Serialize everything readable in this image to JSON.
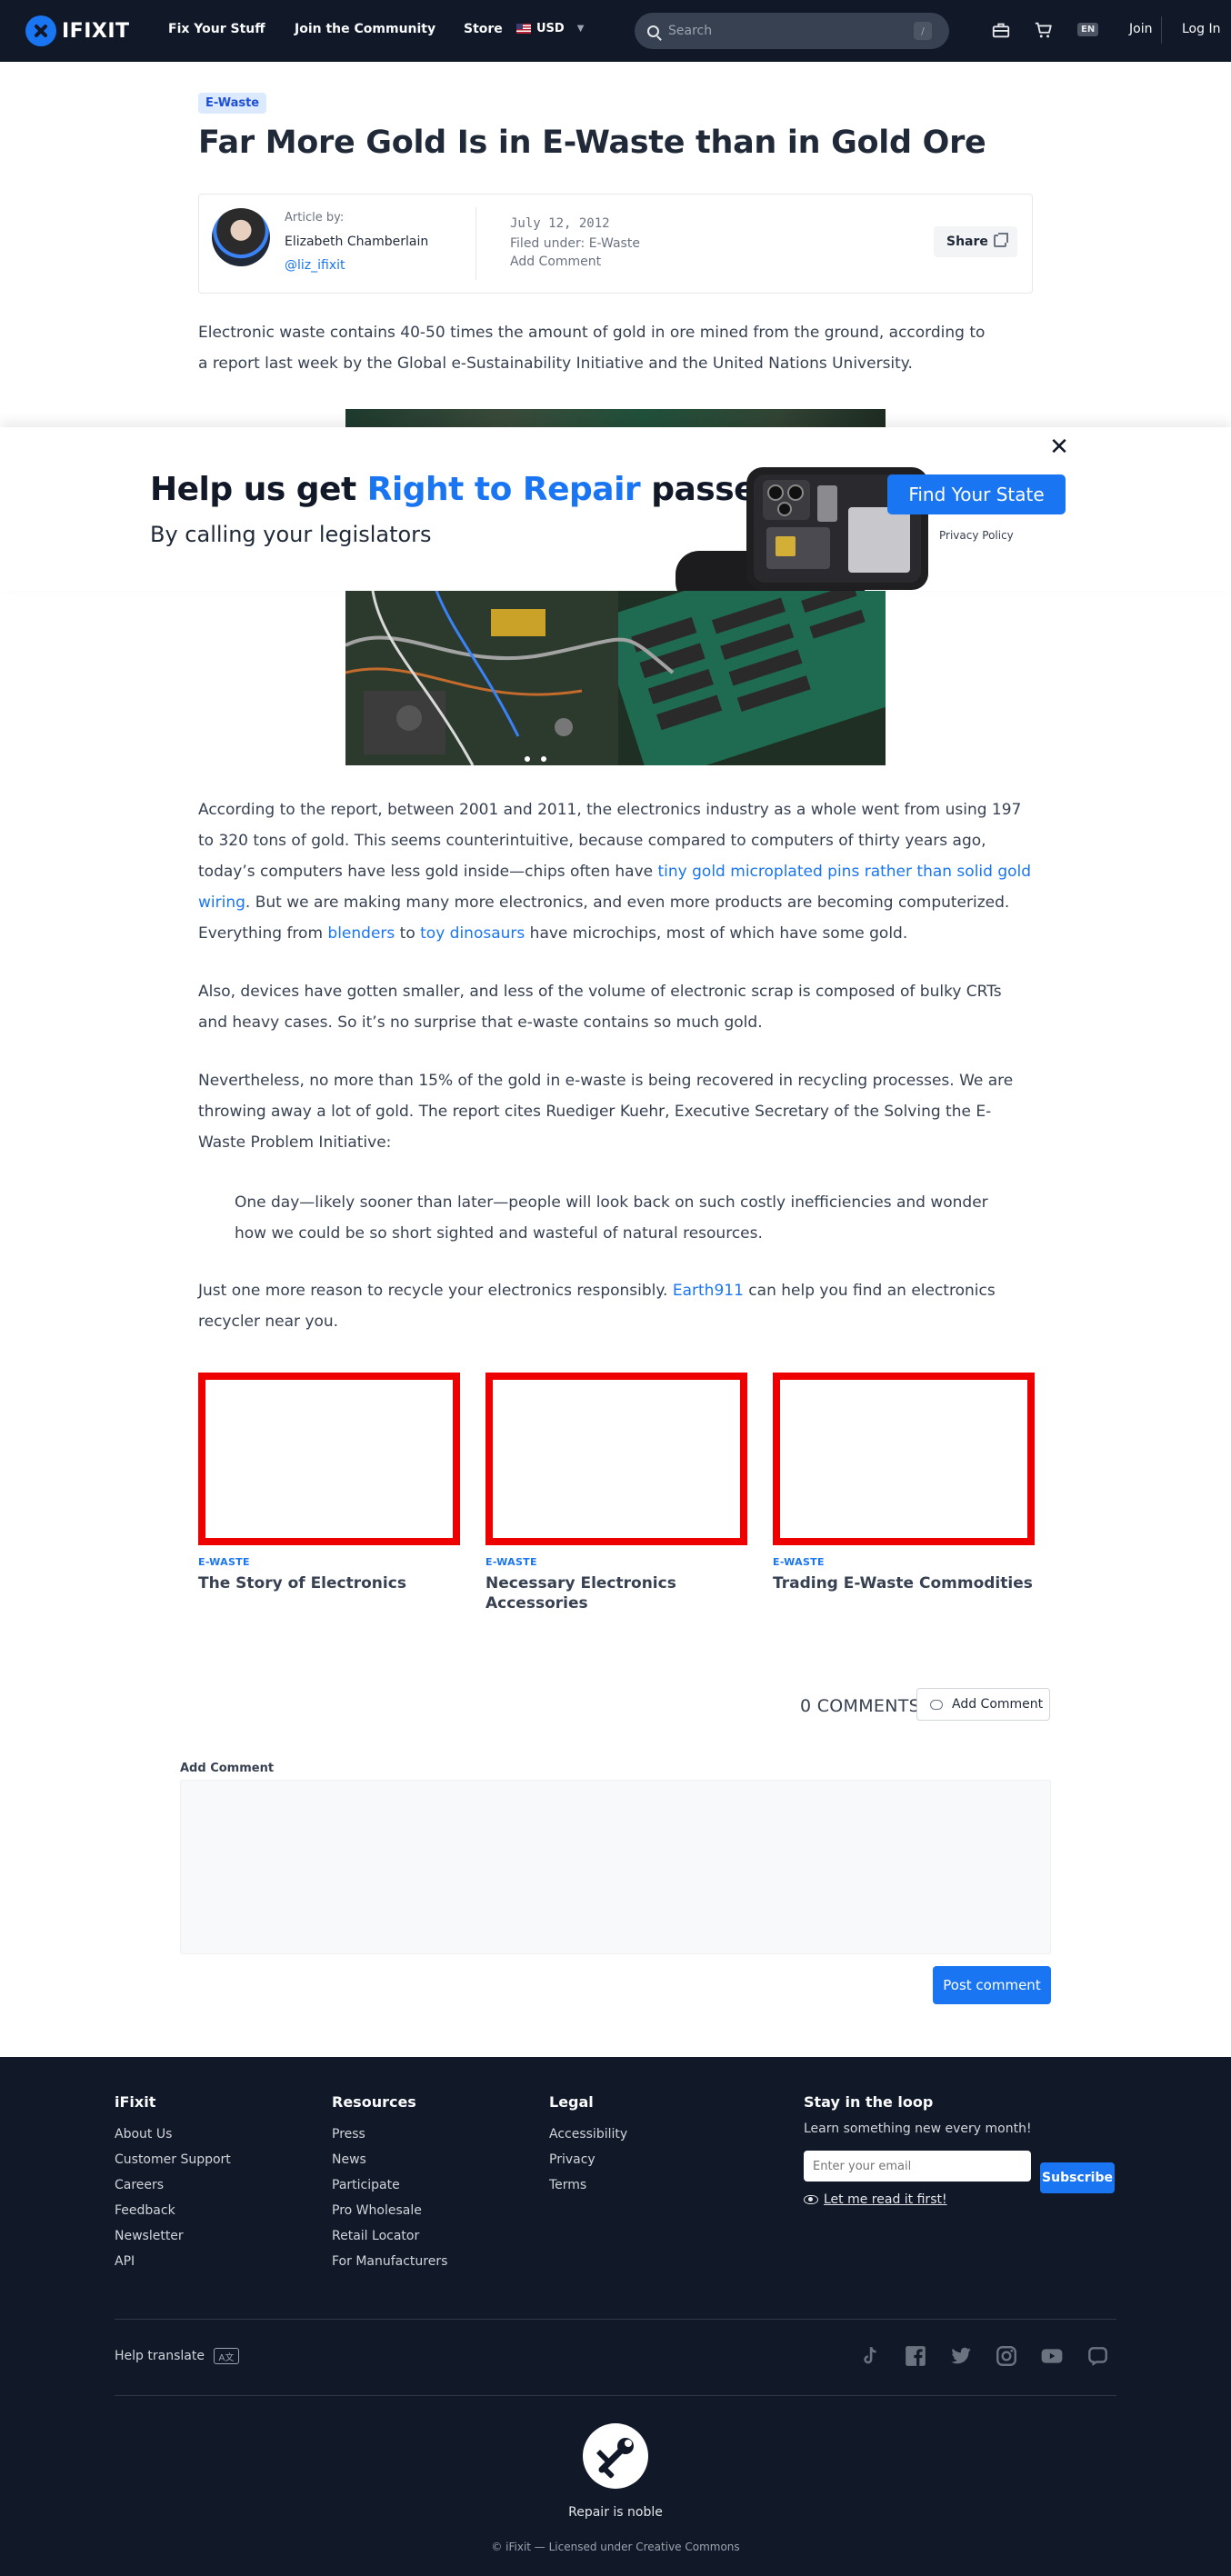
{
  "nav": {
    "logo_text": "IFIXIT",
    "links": [
      "Fix Your Stuff",
      "Join the Community",
      "Store"
    ],
    "currency": "USD",
    "search_placeholder": "Search",
    "search_shortcut": "/",
    "language": "EN",
    "join": "Join",
    "login": "Log In"
  },
  "article": {
    "tag": "E-Waste",
    "title": "Far More Gold Is in E-Waste than in Gold Ore",
    "byline": {
      "label": "Article by:",
      "author": "Elizabeth Chamberlain",
      "handle": "@liz_ifixit",
      "date": "July 12, 2012",
      "filed_label": "Filed under:",
      "filed_value": "E-Waste",
      "add_comment": "Add Comment",
      "share": "Share"
    },
    "lede": "Electronic waste contains 40-50 times the amount of gold in ore mined from the ground, according to a report last week by the Global e-Sustainability Initiative and the United Nations University.",
    "p1_a": "According to the report, between 2001 and 2011, the electronics industry as a whole went from using 197 to 320 tons of gold. This seems counterintuitive, because compared to computers of thirty years ago, today’s computers have less gold inside—chips often have ",
    "p1_link1": "tiny gold microplated pins rather than solid gold wiring",
    "p1_b": ". But we are making many more electronics, and even more products are becoming computerized. Everything from ",
    "p1_link2": "blenders",
    "p1_c": " to ",
    "p1_link3": "toy dinosaurs",
    "p1_d": " have microchips, most of which have some gold.",
    "p2": "Also, devices have gotten smaller, and less of the volume of electronic scrap is composed of bulky CRTs and heavy cases. So it’s no surprise that e-waste contains so much gold.",
    "p3": "Nevertheless, no more than 15% of the gold in e-waste is being recovered in recycling processes. We are throwing away a lot of gold. The report cites Ruediger Kuehr, Executive Secretary of the Solving the E-Waste Problem Initiative:",
    "quote": "One day—likely sooner than later—people will look back on such costly inefficiencies and wonder how we could be so short sighted and wasteful of natural resources.",
    "p4_a": "Just one more reason to recycle your electronics responsibly. ",
    "p4_link": "Earth911",
    "p4_b": " can help you find an electronics recycler near you."
  },
  "banner": {
    "title_a": "Help us get ",
    "title_hl": "Right to Repair",
    "title_b": " passed",
    "subtitle": "By calling your legislators",
    "cta": "Find Your State",
    "privacy": "Privacy Policy",
    "close": "✕"
  },
  "related": [
    {
      "category": "E-WASTE",
      "title": "The Story of Electronics"
    },
    {
      "category": "E-WASTE",
      "title": "Necessary Electronics Accessories"
    },
    {
      "category": "E-WASTE",
      "title": "Trading E-Waste Commodities"
    }
  ],
  "comments": {
    "count_label": "0 COMMENTS",
    "add_button": "Add Comment",
    "form_label": "Add Comment",
    "post_button": "Post comment"
  },
  "footer": {
    "columns": [
      {
        "heading": "iFixit",
        "items": [
          "About Us",
          "Customer Support",
          "Careers",
          "Feedback",
          "Newsletter",
          "API"
        ]
      },
      {
        "heading": "Resources",
        "items": [
          "Press",
          "News",
          "Participate",
          "Pro Wholesale",
          "Retail Locator",
          "For Manufacturers"
        ]
      },
      {
        "heading": "Legal",
        "items": [
          "Accessibility",
          "Privacy",
          "Terms"
        ]
      }
    ],
    "newsletter": {
      "heading": "Stay in the loop",
      "text": "Learn something new every month!",
      "placeholder": "Enter your email",
      "button": "Subscribe",
      "read_first": "Let me read it first!"
    },
    "help_translate": "Help translate",
    "tagline": "Repair is noble",
    "copyright": "© iFixit — Licensed under Creative Commons",
    "social_icons": [
      "tiktok-icon",
      "facebook-icon",
      "twitter-icon",
      "instagram-icon",
      "youtube-icon",
      "mastodon-icon"
    ]
  },
  "colors": {
    "accent": "#1975f2",
    "nav_bg": "#111827",
    "card_border": "#ee0000"
  }
}
